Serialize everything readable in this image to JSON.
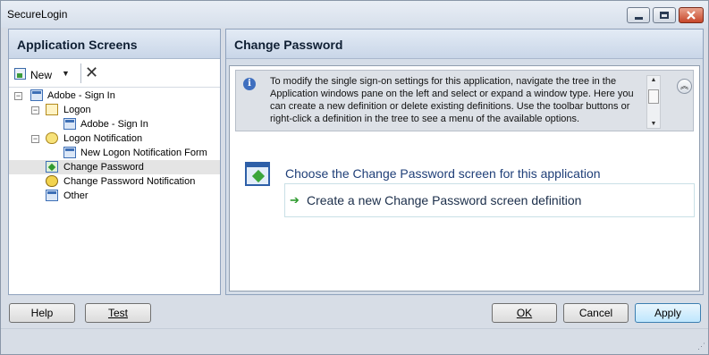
{
  "window": {
    "title": "SecureLogin",
    "controls": [
      "minimize-icon",
      "maximize-icon",
      "close-icon"
    ]
  },
  "left_panel": {
    "title": "Application Screens",
    "toolbar": {
      "new_label": "New",
      "new_accelerator": "N",
      "dropdown_glyph": "▼",
      "delete_glyph": "✕"
    },
    "tree": [
      {
        "label": "Adobe - Sign In",
        "level": 0,
        "expander": "−",
        "icon": "application-icon"
      },
      {
        "label": "Logon",
        "level": 1,
        "expander": "−",
        "icon": "logon-icon"
      },
      {
        "label": "Adobe - Sign In",
        "level": 2,
        "expander": "",
        "icon": "window-icon"
      },
      {
        "label": "Logon Notification",
        "level": 1,
        "expander": "−",
        "icon": "notification-icon"
      },
      {
        "label": "New Logon Notification Form",
        "level": 2,
        "expander": "",
        "icon": "window-icon"
      },
      {
        "label": "Change Password",
        "level": 1,
        "expander": "",
        "icon": "change-password-icon",
        "selected": true
      },
      {
        "label": "Change Password Notification",
        "level": 1,
        "expander": "",
        "icon": "password-notification-icon"
      },
      {
        "label": "Other",
        "level": 1,
        "expander": "",
        "icon": "window-icon"
      }
    ]
  },
  "right_panel": {
    "title": "Change Password",
    "info_text": "To modify the single sign-on settings for this application, navigate the tree in the Application windows pane on the left and select or expand a window type. Here you can create a new definition or delete existing definitions. Use the toolbar buttons or right-click a definition in the tree to see a menu of the available options.",
    "info_icon_glyph": "i",
    "collapse_glyph": "︽",
    "choose_title": "Choose the Change Password screen for this application",
    "create_label": "Create a new Change Password screen definition",
    "create_arrow_glyph": "➔"
  },
  "buttons": {
    "help": "Help",
    "test": "Test",
    "ok": "OK",
    "cancel": "Cancel",
    "apply": "Apply"
  }
}
